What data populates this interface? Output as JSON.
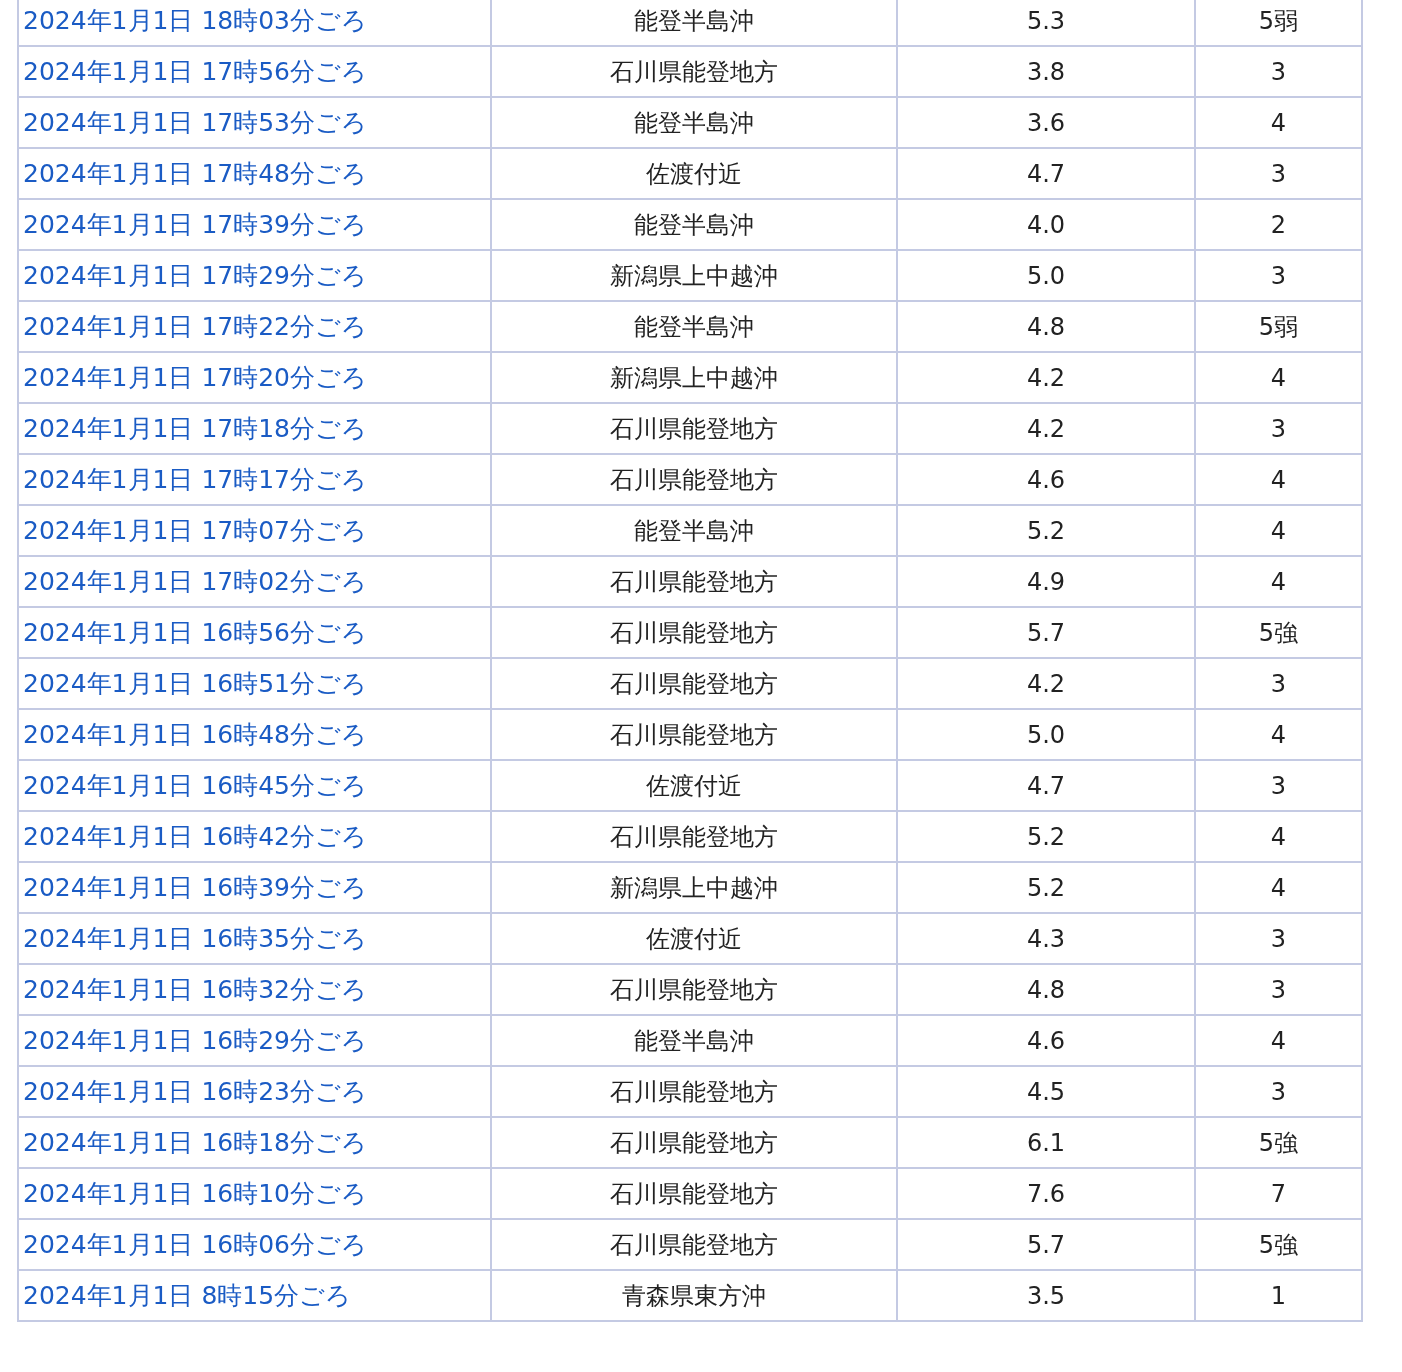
{
  "table": {
    "rows": [
      {
        "time": "2024年1月1日 18時03分ごろ",
        "place": "能登半島沖",
        "magnitude": "5.3",
        "intensity": "5弱"
      },
      {
        "time": "2024年1月1日 17時56分ごろ",
        "place": "石川県能登地方",
        "magnitude": "3.8",
        "intensity": "3"
      },
      {
        "time": "2024年1月1日 17時53分ごろ",
        "place": "能登半島沖",
        "magnitude": "3.6",
        "intensity": "4"
      },
      {
        "time": "2024年1月1日 17時48分ごろ",
        "place": "佐渡付近",
        "magnitude": "4.7",
        "intensity": "3"
      },
      {
        "time": "2024年1月1日 17時39分ごろ",
        "place": "能登半島沖",
        "magnitude": "4.0",
        "intensity": "2"
      },
      {
        "time": "2024年1月1日 17時29分ごろ",
        "place": "新潟県上中越沖",
        "magnitude": "5.0",
        "intensity": "3"
      },
      {
        "time": "2024年1月1日 17時22分ごろ",
        "place": "能登半島沖",
        "magnitude": "4.8",
        "intensity": "5弱"
      },
      {
        "time": "2024年1月1日 17時20分ごろ",
        "place": "新潟県上中越沖",
        "magnitude": "4.2",
        "intensity": "4"
      },
      {
        "time": "2024年1月1日 17時18分ごろ",
        "place": "石川県能登地方",
        "magnitude": "4.2",
        "intensity": "3"
      },
      {
        "time": "2024年1月1日 17時17分ごろ",
        "place": "石川県能登地方",
        "magnitude": "4.6",
        "intensity": "4"
      },
      {
        "time": "2024年1月1日 17時07分ごろ",
        "place": "能登半島沖",
        "magnitude": "5.2",
        "intensity": "4"
      },
      {
        "time": "2024年1月1日 17時02分ごろ",
        "place": "石川県能登地方",
        "magnitude": "4.9",
        "intensity": "4"
      },
      {
        "time": "2024年1月1日 16時56分ごろ",
        "place": "石川県能登地方",
        "magnitude": "5.7",
        "intensity": "5強"
      },
      {
        "time": "2024年1月1日 16時51分ごろ",
        "place": "石川県能登地方",
        "magnitude": "4.2",
        "intensity": "3"
      },
      {
        "time": "2024年1月1日 16時48分ごろ",
        "place": "石川県能登地方",
        "magnitude": "5.0",
        "intensity": "4"
      },
      {
        "time": "2024年1月1日 16時45分ごろ",
        "place": "佐渡付近",
        "magnitude": "4.7",
        "intensity": "3"
      },
      {
        "time": "2024年1月1日 16時42分ごろ",
        "place": "石川県能登地方",
        "magnitude": "5.2",
        "intensity": "4"
      },
      {
        "time": "2024年1月1日 16時39分ごろ",
        "place": "新潟県上中越沖",
        "magnitude": "5.2",
        "intensity": "4"
      },
      {
        "time": "2024年1月1日 16時35分ごろ",
        "place": "佐渡付近",
        "magnitude": "4.3",
        "intensity": "3"
      },
      {
        "time": "2024年1月1日 16時32分ごろ",
        "place": "石川県能登地方",
        "magnitude": "4.8",
        "intensity": "3"
      },
      {
        "time": "2024年1月1日 16時29分ごろ",
        "place": "能登半島沖",
        "magnitude": "4.6",
        "intensity": "4"
      },
      {
        "time": "2024年1月1日 16時23分ごろ",
        "place": "石川県能登地方",
        "magnitude": "4.5",
        "intensity": "3"
      },
      {
        "time": "2024年1月1日 16時18分ごろ",
        "place": "石川県能登地方",
        "magnitude": "6.1",
        "intensity": "5強"
      },
      {
        "time": "2024年1月1日 16時10分ごろ",
        "place": "石川県能登地方",
        "magnitude": "7.6",
        "intensity": "7"
      },
      {
        "time": "2024年1月1日 16時06分ごろ",
        "place": "石川県能登地方",
        "magnitude": "5.7",
        "intensity": "5強"
      },
      {
        "time": "2024年1月1日 8時15分ごろ",
        "place": "青森県東方沖",
        "magnitude": "3.5",
        "intensity": "1"
      }
    ]
  }
}
